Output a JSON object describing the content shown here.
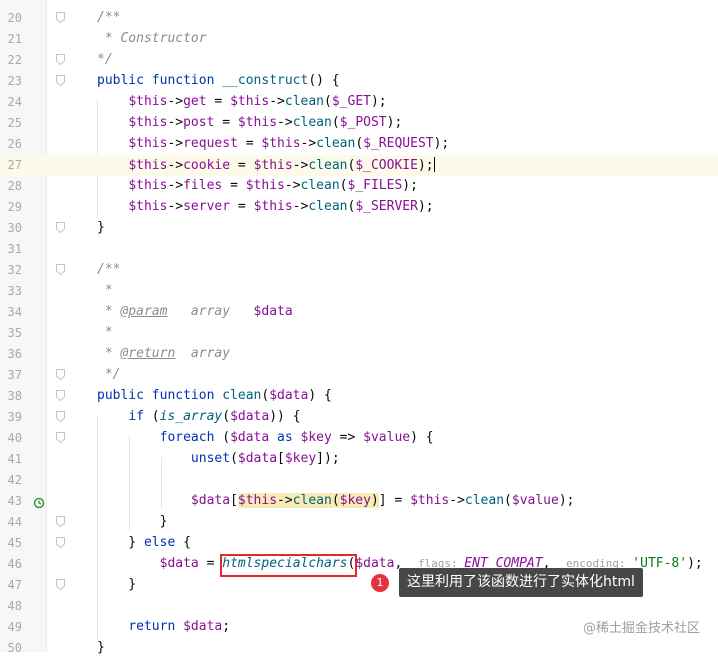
{
  "lines": [
    {
      "n": "20",
      "fold": true,
      "tokens": [
        [
          "c-comment",
          "/**"
        ]
      ]
    },
    {
      "n": "21",
      "tokens": [
        [
          "c-comment",
          " * Constructor"
        ]
      ]
    },
    {
      "n": "22",
      "fold": true,
      "tokens": [
        [
          "c-comment",
          "*/"
        ]
      ]
    },
    {
      "n": "23",
      "fold": true,
      "tokens": [
        [
          "c-kw",
          "public function "
        ],
        [
          "c-fn",
          "__construct"
        ],
        [
          "",
          "() {"
        ]
      ]
    },
    {
      "n": "24",
      "tokens": [
        [
          "",
          "    "
        ],
        [
          "c-var",
          "$this"
        ],
        [
          "",
          "->"
        ],
        [
          "c-var",
          "get"
        ],
        [
          "",
          " = "
        ],
        [
          "c-var",
          "$this"
        ],
        [
          "",
          "->"
        ],
        [
          "c-fn",
          "clean"
        ],
        [
          "",
          "("
        ],
        [
          "c-var",
          "$_GET"
        ],
        [
          "",
          ");"
        ]
      ]
    },
    {
      "n": "25",
      "tokens": [
        [
          "",
          "    "
        ],
        [
          "c-var",
          "$this"
        ],
        [
          "",
          "->"
        ],
        [
          "c-var",
          "post"
        ],
        [
          "",
          " = "
        ],
        [
          "c-var",
          "$this"
        ],
        [
          "",
          "->"
        ],
        [
          "c-fn",
          "clean"
        ],
        [
          "",
          "("
        ],
        [
          "c-var",
          "$_POST"
        ],
        [
          "",
          ");"
        ]
      ]
    },
    {
      "n": "26",
      "tokens": [
        [
          "",
          "    "
        ],
        [
          "c-var",
          "$this"
        ],
        [
          "",
          "->"
        ],
        [
          "c-var",
          "request"
        ],
        [
          "",
          " = "
        ],
        [
          "c-var",
          "$this"
        ],
        [
          "",
          "->"
        ],
        [
          "c-fn",
          "clean"
        ],
        [
          "",
          "("
        ],
        [
          "c-var",
          "$_REQUEST"
        ],
        [
          "",
          ");"
        ]
      ]
    },
    {
      "n": "27",
      "current": true,
      "tokens": [
        [
          "",
          "    "
        ],
        [
          "c-var",
          "$this"
        ],
        [
          "",
          "->"
        ],
        [
          "c-var",
          "cookie"
        ],
        [
          "",
          " = "
        ],
        [
          "c-var",
          "$this"
        ],
        [
          "",
          "->"
        ],
        [
          "c-fn",
          "clean"
        ],
        [
          "",
          "("
        ],
        [
          "c-var",
          "$_COOKIE"
        ],
        [
          "",
          ");"
        ]
      ]
    },
    {
      "n": "28",
      "tokens": [
        [
          "",
          "    "
        ],
        [
          "c-var",
          "$this"
        ],
        [
          "",
          "->"
        ],
        [
          "c-var",
          "files"
        ],
        [
          "",
          " = "
        ],
        [
          "c-var",
          "$this"
        ],
        [
          "",
          "->"
        ],
        [
          "c-fn",
          "clean"
        ],
        [
          "",
          "("
        ],
        [
          "c-var",
          "$_FILES"
        ],
        [
          "",
          ");"
        ]
      ]
    },
    {
      "n": "29",
      "tokens": [
        [
          "",
          "    "
        ],
        [
          "c-var",
          "$this"
        ],
        [
          "",
          "->"
        ],
        [
          "c-var",
          "server"
        ],
        [
          "",
          " = "
        ],
        [
          "c-var",
          "$this"
        ],
        [
          "",
          "->"
        ],
        [
          "c-fn",
          "clean"
        ],
        [
          "",
          "("
        ],
        [
          "c-var",
          "$_SERVER"
        ],
        [
          "",
          ");"
        ]
      ]
    },
    {
      "n": "30",
      "fold": true,
      "tokens": [
        [
          "",
          "}"
        ]
      ]
    },
    {
      "n": "31",
      "tokens": []
    },
    {
      "n": "32",
      "fold": true,
      "tokens": [
        [
          "c-comment",
          "/**"
        ]
      ]
    },
    {
      "n": "33",
      "tokens": [
        [
          "c-comment",
          " *"
        ]
      ]
    },
    {
      "n": "34",
      "tokens": [
        [
          "c-comment",
          " * "
        ],
        [
          "c-tag",
          "@param"
        ],
        [
          "c-comment",
          "   array   "
        ],
        [
          "c-var",
          "$data"
        ]
      ]
    },
    {
      "n": "35",
      "tokens": [
        [
          "c-comment",
          " *"
        ]
      ]
    },
    {
      "n": "36",
      "tokens": [
        [
          "c-comment",
          " * "
        ],
        [
          "c-tag",
          "@return"
        ],
        [
          "c-comment",
          "  array"
        ]
      ]
    },
    {
      "n": "37",
      "fold": true,
      "tokens": [
        [
          "c-comment",
          " */"
        ]
      ]
    },
    {
      "n": "38",
      "fold": true,
      "tokens": [
        [
          "c-kw",
          "public function "
        ],
        [
          "c-fn",
          "clean"
        ],
        [
          "",
          "("
        ],
        [
          "c-var",
          "$data"
        ],
        [
          "",
          ") {"
        ]
      ]
    },
    {
      "n": "39",
      "fold": true,
      "tokens": [
        [
          "",
          "    "
        ],
        [
          "c-kw",
          "if"
        ],
        [
          "",
          " ("
        ],
        [
          "c-fni",
          "is_array"
        ],
        [
          "",
          "("
        ],
        [
          "c-var",
          "$data"
        ],
        [
          "",
          ")) {"
        ]
      ]
    },
    {
      "n": "40",
      "fold": true,
      "tokens": [
        [
          "",
          "        "
        ],
        [
          "c-kw",
          "foreach"
        ],
        [
          "",
          " ("
        ],
        [
          "c-var",
          "$data"
        ],
        [
          "c-kw",
          " as "
        ],
        [
          "c-var",
          "$key"
        ],
        [
          "",
          " => "
        ],
        [
          "c-var",
          "$value"
        ],
        [
          "",
          ") {"
        ]
      ]
    },
    {
      "n": "41",
      "tokens": [
        [
          "",
          "            "
        ],
        [
          "c-kw",
          "unset"
        ],
        [
          "",
          "("
        ],
        [
          "c-var",
          "$data"
        ],
        [
          "",
          "["
        ],
        [
          "c-var",
          "$key"
        ],
        [
          "",
          "]);"
        ]
      ]
    },
    {
      "n": "42",
      "tokens": []
    },
    {
      "n": "43",
      "tokens": [
        [
          "",
          "            "
        ],
        [
          "c-var",
          "$data"
        ],
        [
          "",
          "["
        ],
        [
          "c-var c-hl",
          "$this"
        ],
        [
          "c-hl",
          "->"
        ],
        [
          "c-fn c-hl",
          "clean"
        ],
        [
          "c-hl",
          "("
        ],
        [
          "c-var c-hl",
          "$key"
        ],
        [
          "c-hl",
          ")"
        ],
        [
          "",
          "] = "
        ],
        [
          "c-var",
          "$this"
        ],
        [
          "",
          "->"
        ],
        [
          "c-fn",
          "clean"
        ],
        [
          "",
          "("
        ],
        [
          "c-var",
          "$value"
        ],
        [
          "",
          ");"
        ]
      ]
    },
    {
      "n": "44",
      "fold": true,
      "tokens": [
        [
          "",
          "        }"
        ]
      ]
    },
    {
      "n": "45",
      "fold": true,
      "tokens": [
        [
          "",
          "    } "
        ],
        [
          "c-kw",
          "else"
        ],
        [
          "",
          " {"
        ]
      ]
    },
    {
      "n": "46",
      "tokens": [
        [
          "",
          "        "
        ],
        [
          "c-var",
          "$data"
        ],
        [
          "",
          " = "
        ],
        [
          "c-fni",
          "htmlspecialchars"
        ],
        [
          "",
          "("
        ],
        [
          "c-var",
          "$data"
        ],
        [
          "",
          ",  "
        ],
        [
          "c-hint",
          "flags: "
        ],
        [
          "c-const",
          "ENT_COMPAT"
        ],
        [
          "",
          ",  "
        ],
        [
          "c-hint",
          "encoding: "
        ],
        [
          "c-str",
          "'UTF-8'"
        ],
        [
          "",
          ");"
        ]
      ]
    },
    {
      "n": "47",
      "fold": true,
      "tokens": [
        [
          "",
          "    }"
        ]
      ]
    },
    {
      "n": "48",
      "tokens": []
    },
    {
      "n": "49",
      "tokens": [
        [
          "",
          "    "
        ],
        [
          "c-kw",
          "return "
        ],
        [
          "c-var",
          "$data"
        ],
        [
          "",
          ";"
        ]
      ]
    },
    {
      "n": "50",
      "tokens": [
        [
          "",
          "}"
        ]
      ]
    }
  ],
  "annotation": {
    "badge": "1",
    "text": "这里利用了该函数进行了实体化html"
  },
  "watermark": "@稀土掘金技术社区"
}
